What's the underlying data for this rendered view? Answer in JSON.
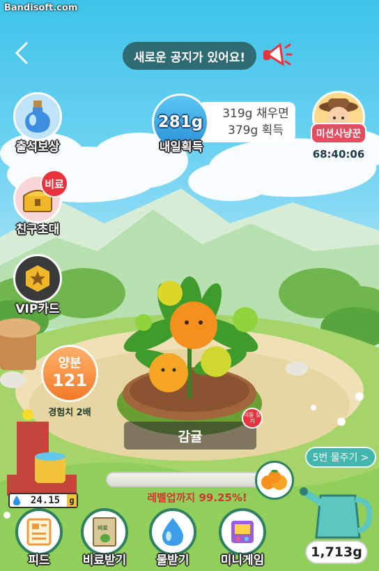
{
  "watermark": "Bandisoft.com",
  "notice": "새로운 공지가 있어요!",
  "side": {
    "attendance": "출석보상",
    "invite": "친구초대",
    "invite_badge": "비료",
    "vip": "VIP카드"
  },
  "yield": {
    "amount": "281g",
    "label": "내일획득",
    "line1": "319g 채우면",
    "line2": "379g 획득"
  },
  "mission": {
    "title": "미션사냥꾼",
    "timer": "68:40:06"
  },
  "nutrient": {
    "title": "양분",
    "value": "121",
    "sub": "경험치 2배"
  },
  "plant": {
    "name": "감귤",
    "move_tag": "이동 찾기"
  },
  "water_button": "5번 물주기 >",
  "level": {
    "text": "레벨업까지 99.25%!",
    "percent": 99.25
  },
  "water_stock": "24.15",
  "water_stock_unit": "g",
  "can_amount": "1,713g",
  "bottom": {
    "feed": "피드",
    "fertilizer": "비료받기",
    "fertilizer_bag": "비료",
    "water": "물받기",
    "minigame": "미니게임"
  },
  "colors": {
    "accent_green": "#2f7f62",
    "notice_bg": "#2f6b72",
    "level_red": "#d2362f",
    "yield_blue": "#2a8fd6",
    "nutrient_orange": "#f07b2a"
  }
}
